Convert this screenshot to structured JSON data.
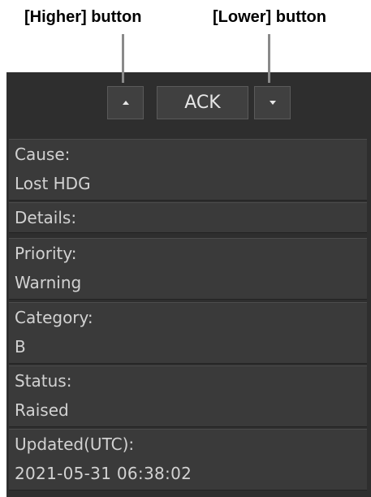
{
  "callouts": {
    "higher": "[Higher] button",
    "lower": "[Lower] button"
  },
  "toolbar": {
    "higher_icon": "triangle-up-icon",
    "ack_label": "ACK",
    "lower_icon": "triangle-down-icon"
  },
  "fields": {
    "cause": {
      "label": "Cause:",
      "value": "Lost HDG"
    },
    "details": {
      "label": "Details:"
    },
    "priority": {
      "label": "Priority:",
      "value": "Warning"
    },
    "category": {
      "label": "Category:",
      "value": "B"
    },
    "status": {
      "label": "Status:",
      "value": "Raised"
    },
    "updated": {
      "label": "Updated(UTC):",
      "value": "2021-05-31 06:38:02"
    }
  },
  "colors": {
    "panel_bg": "#2e2e2e",
    "field_bg": "#3a3a3a",
    "button_bg": "#404040",
    "text": "#d2d2d2",
    "leader_line": "#8a8a8a"
  }
}
